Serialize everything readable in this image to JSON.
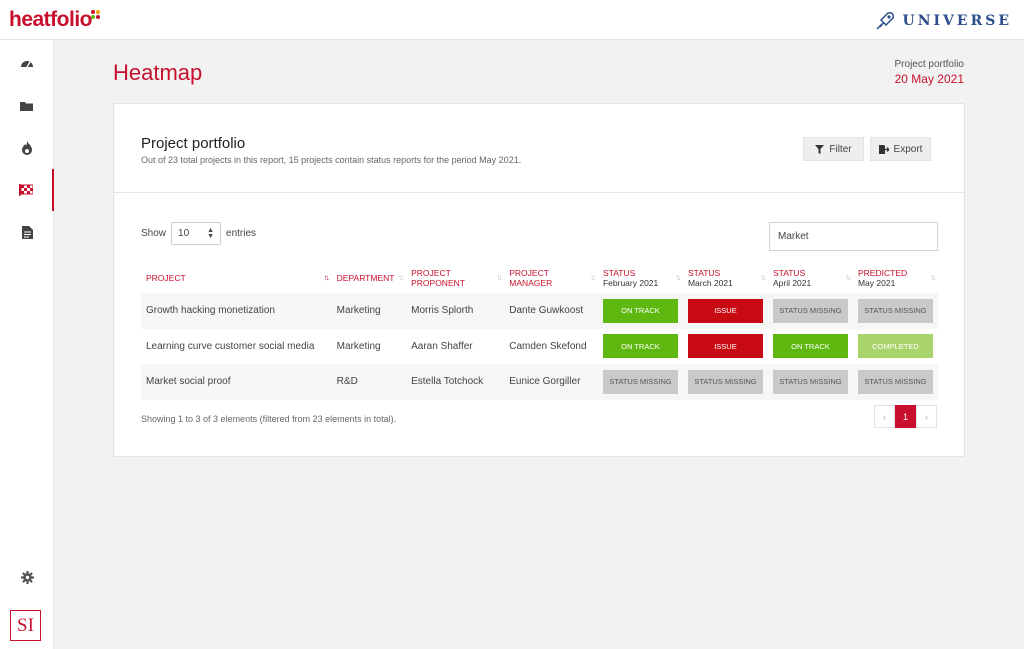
{
  "app": {
    "logo_text": "heatfolio",
    "brand_right": "UNIVERSE"
  },
  "colors": {
    "accent": "#c8102e",
    "on_track": "#5fb80f",
    "issue": "#c80a13",
    "missing": "#c9c9c9",
    "completed": "#a9d46b"
  },
  "sidebar": {
    "items": [
      {
        "icon": "dashboard-icon"
      },
      {
        "icon": "folder-icon"
      },
      {
        "icon": "flame-icon"
      },
      {
        "icon": "heatmap-flag-icon",
        "active": true
      },
      {
        "icon": "document-icon"
      }
    ],
    "settings_icon": "gear-icon",
    "user_badge": "SI"
  },
  "page": {
    "title": "Heatmap",
    "report_label": "Project portfolio",
    "report_date": "20 May 2021"
  },
  "card": {
    "title": "Project portfolio",
    "subtitle": "Out of 23 total projects in this report, 15 projects contain status reports for the period May 2021.",
    "filter_label": "Filter",
    "export_label": "Export"
  },
  "table_controls": {
    "show_label": "Show",
    "entries_value": "10",
    "entries_label": "entries",
    "search_value": "Market"
  },
  "table": {
    "headers": [
      {
        "title": "PROJECT",
        "sub": ""
      },
      {
        "title": "DEPARTMENT",
        "sub": ""
      },
      {
        "title": "PROJECT PROPONENT",
        "sub": ""
      },
      {
        "title": "PROJECT MANAGER",
        "sub": ""
      },
      {
        "title": "STATUS",
        "sub": "February 2021"
      },
      {
        "title": "STATUS",
        "sub": "March 2021"
      },
      {
        "title": "STATUS",
        "sub": "April 2021"
      },
      {
        "title": "PREDICTED",
        "sub": "May 2021"
      }
    ],
    "rows": [
      {
        "project": "Growth hacking monetization",
        "department": "Marketing",
        "proponent": "Morris Splorth",
        "manager": "Dante Guwkoost",
        "statuses": [
          {
            "text": "ON TRACK",
            "kind": "on"
          },
          {
            "text": "ISSUE",
            "kind": "issue"
          },
          {
            "text": "STATUS MISSING",
            "kind": "missing"
          },
          {
            "text": "STATUS MISSING",
            "kind": "missing"
          }
        ]
      },
      {
        "project": "Learning curve customer social media",
        "department": "Marketing",
        "proponent": "Aaran Shaffer",
        "manager": "Camden Skefond",
        "statuses": [
          {
            "text": "ON TRACK",
            "kind": "on"
          },
          {
            "text": "ISSUE",
            "kind": "issue"
          },
          {
            "text": "ON TRACK",
            "kind": "on"
          },
          {
            "text": "COMPLETED",
            "kind": "completed"
          }
        ]
      },
      {
        "project": "Market social proof",
        "department": "R&D",
        "proponent": "Estella Totchock",
        "manager": "Eunice Gorgiller",
        "statuses": [
          {
            "text": "STATUS MISSING",
            "kind": "missing"
          },
          {
            "text": "STATUS MISSING",
            "kind": "missing"
          },
          {
            "text": "STATUS MISSING",
            "kind": "missing"
          },
          {
            "text": "STATUS MISSING",
            "kind": "missing"
          }
        ]
      }
    ]
  },
  "footer": {
    "summary": "Showing 1 to 3 of 3 elements (filtered from 23 elements in total).",
    "prev": "‹",
    "current_page": "1",
    "next": "›"
  }
}
